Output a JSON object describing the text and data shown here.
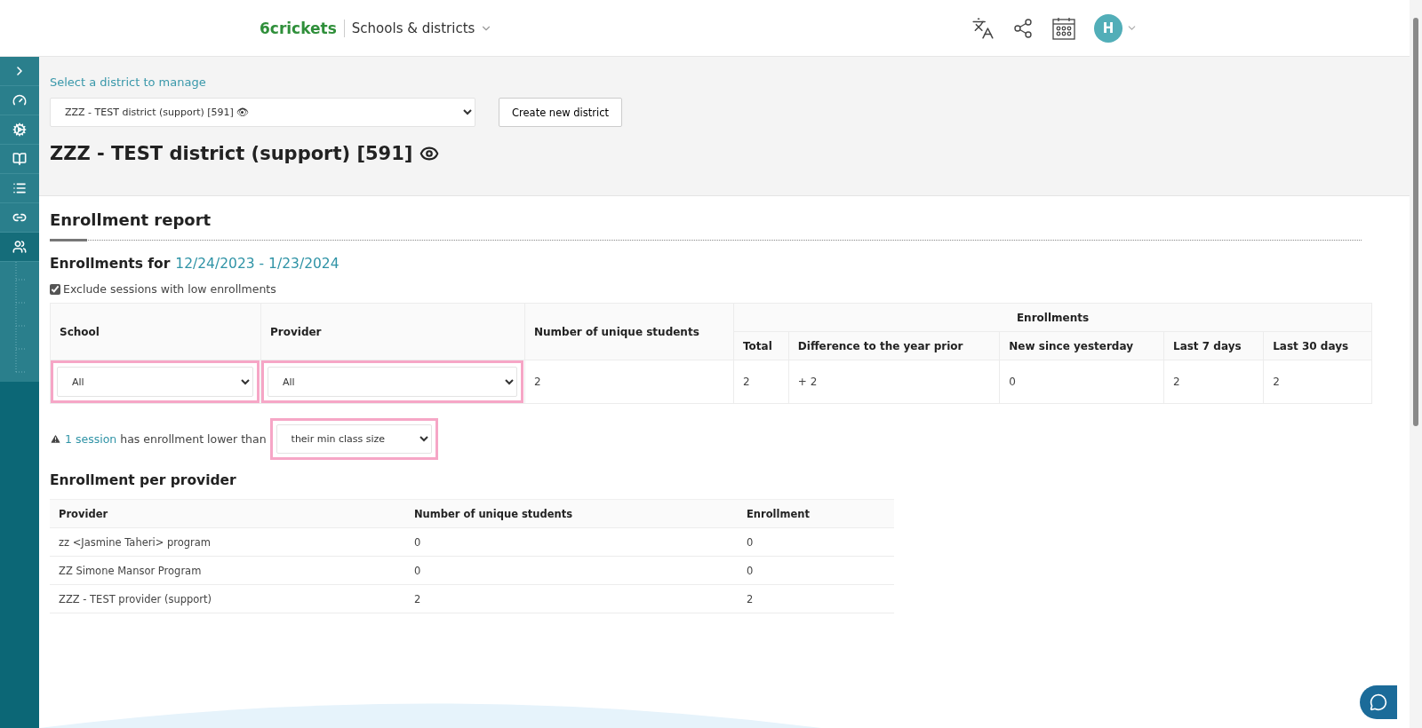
{
  "header": {
    "logo": "6crickets",
    "section": "Schools & districts",
    "avatar": "H"
  },
  "sidebar": {
    "items": [
      {
        "selected": false
      },
      {
        "selected": false
      },
      {
        "selected": false
      },
      {
        "selected": false
      },
      {
        "selected": false
      },
      {
        "selected": false
      },
      {
        "selected": true
      }
    ]
  },
  "district": {
    "prompt": "Select a district to manage",
    "select_value": "ZZZ - TEST district (support) [591] 👁",
    "create_button": "Create new district",
    "title": "ZZZ - TEST district (support) [591]"
  },
  "report": {
    "title": "Enrollment report",
    "period_label": "Enrollments for",
    "period": "12/24/2023 - 1/23/2024",
    "exclude": {
      "label": "Exclude sessions with low enrollments",
      "checked": true
    },
    "table": {
      "columns": [
        "School",
        "Provider",
        "Number of unique students"
      ],
      "group": "Enrollments",
      "subcolumns": [
        "Total",
        "Difference to the year prior",
        "New since yesterday",
        "Last 7 days",
        "Last 30 days"
      ],
      "filters": [
        {
          "value": "All",
          "highlighted": true
        },
        {
          "value": "All",
          "highlighted": true
        }
      ],
      "cells": [
        "2",
        "2",
        "+ 2",
        "0",
        "2",
        "2"
      ]
    },
    "warning": {
      "link": "1 session",
      "text": "has enrollment lower than",
      "select_value": "their min class size",
      "highlighted": true
    }
  },
  "per_provider": {
    "title": "Enrollment per provider",
    "columns": [
      "Provider",
      "Number of unique students",
      "Enrollment"
    ],
    "rows": [
      [
        "zz <Jasmine Taheri> program",
        "0",
        "0"
      ],
      [
        "ZZ Simone Mansor Program",
        "0",
        "0"
      ],
      [
        "ZZZ - TEST provider (support)",
        "2",
        "2"
      ]
    ]
  }
}
